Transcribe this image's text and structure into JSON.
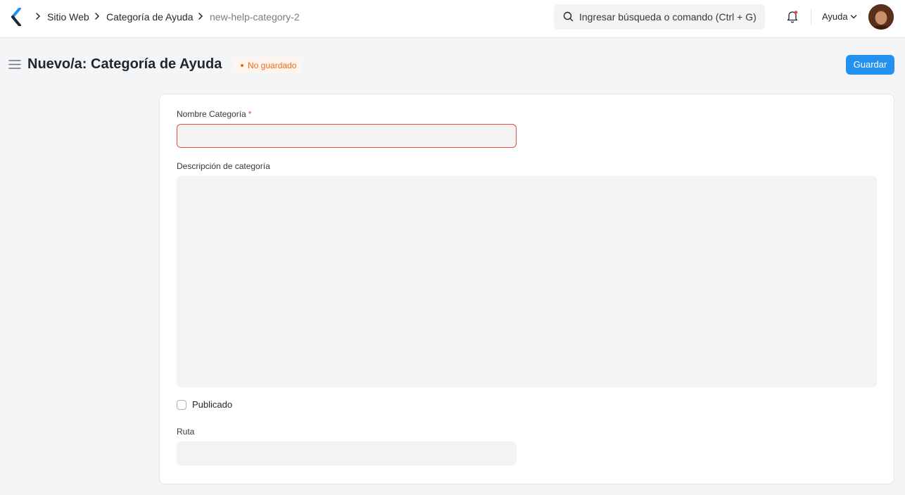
{
  "navbar": {
    "breadcrumbs": [
      {
        "label": "Sitio Web"
      },
      {
        "label": "Categoría de Ayuda"
      },
      {
        "label": "new-help-category-2"
      }
    ],
    "search": {
      "placeholder": "Ingresar búsqueda o comando (Ctrl + G)"
    },
    "help_label": "Ayuda",
    "icons": {
      "logo": "frappe-logo-icon",
      "bell": "notification-bell-icon",
      "search": "search-icon",
      "chevron": "chevron-down-icon"
    }
  },
  "page": {
    "title": "Nuevo/a: Categoría de Ayuda",
    "status": "No guardado",
    "save_label": "Guardar"
  },
  "form": {
    "category_name": {
      "label": "Nombre Categoría",
      "required_mark": "*",
      "value": ""
    },
    "description": {
      "label": "Descripción de categoría",
      "value": ""
    },
    "published": {
      "label": "Publicado",
      "checked": false
    },
    "route": {
      "label": "Ruta",
      "value": ""
    }
  },
  "colors": {
    "primary": "#2490ef",
    "status_orange": "#e86c13",
    "error_red": "#e24c4c",
    "page_bg": "#f4f5f6"
  }
}
